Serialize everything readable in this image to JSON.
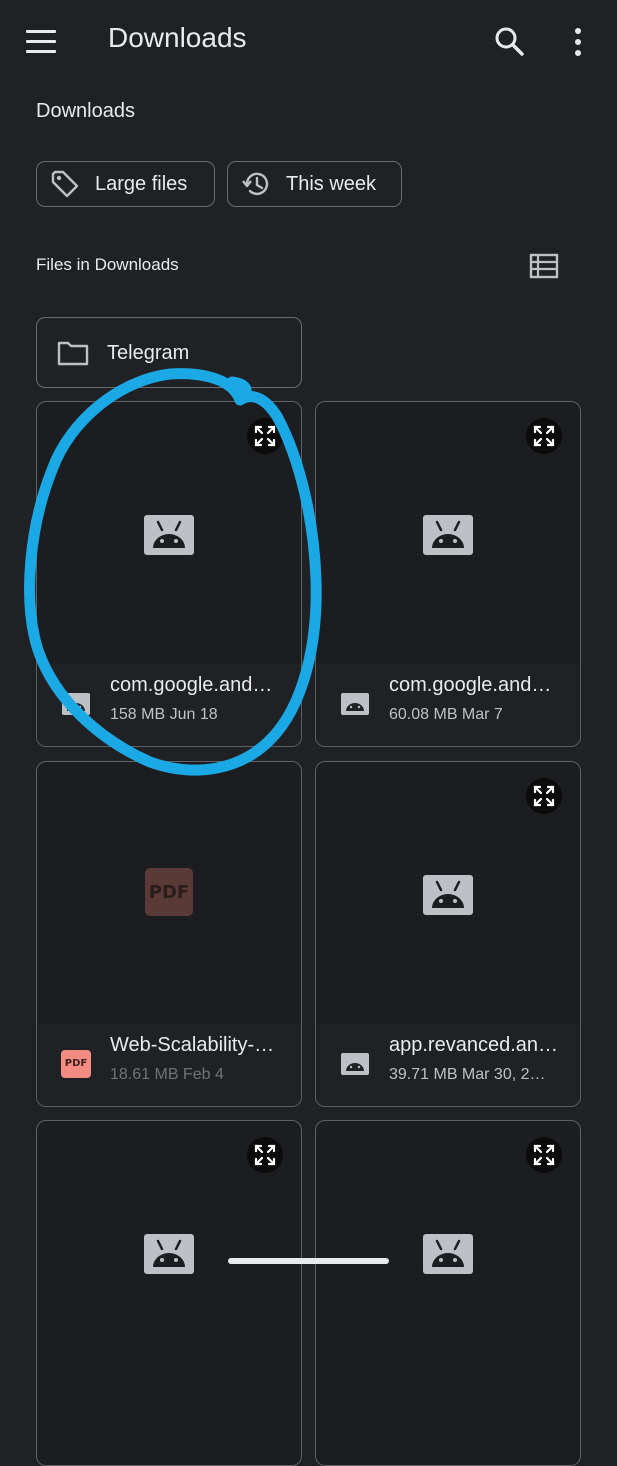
{
  "app_bar": {
    "title": "Downloads",
    "menu_icon": "menu-icon",
    "search_icon": "search-icon",
    "more_icon": "more-vert-icon"
  },
  "section_title": "Downloads",
  "chips": [
    {
      "label": "Large files",
      "icon": "label-tag-icon"
    },
    {
      "label": "This week",
      "icon": "history-icon"
    }
  ],
  "files_header": {
    "title": "Files in Downloads",
    "view_toggle_icon": "list-view-icon"
  },
  "folders": [
    {
      "name": "Telegram",
      "icon": "folder-icon"
    }
  ],
  "files": [
    {
      "name": "com.google.android",
      "display_name": "com.google.and…",
      "meta": "158 MB  Jun 18",
      "type": "apk",
      "highlighted": true
    },
    {
      "name": "com.google.android",
      "display_name": "com.google.and…",
      "meta": "60.08 MB  Mar 7",
      "type": "apk",
      "highlighted": false
    },
    {
      "name": "Web-Scalability-",
      "display_name": "Web-Scalability-…",
      "meta": "18.61 MB  Feb 4",
      "type": "pdf",
      "highlighted": false
    },
    {
      "name": "app.revanced.android",
      "display_name": "app.revanced.an…",
      "meta": "39.71 MB  Mar 30, 2…",
      "type": "apk",
      "highlighted": false
    },
    {
      "type": "apk",
      "partial": true
    },
    {
      "type": "apk",
      "partial": true
    }
  ],
  "pdf_badge_text": "PDF",
  "colors": {
    "background": "#202124",
    "card_border": "#5f6164",
    "annotation_stroke": "#1ba9e6",
    "pdf_accent": "#f28b82"
  }
}
